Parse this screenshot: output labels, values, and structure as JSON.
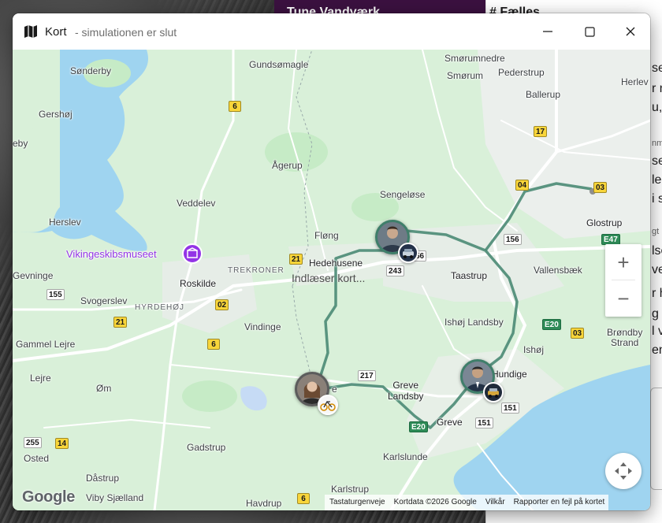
{
  "background": {
    "purple_panel_title": "Tune Vandværk",
    "chat_title": "# Fælles",
    "chat_fragments": [
      "se",
      "r n",
      "u,",
      "nm",
      "se",
      "leg",
      "i s",
      "gt",
      "lse",
      "ve",
      "r h",
      "g",
      "l v",
      "en",
      "ka"
    ]
  },
  "window": {
    "title": "Kort",
    "subtitle": "- simulationen er slut",
    "controls": {
      "minimize": "minimize",
      "maximize": "maximize",
      "close": "close"
    }
  },
  "map": {
    "loading_text": "Indlæser kort...",
    "places": {
      "gundsomagle": "Gundsømagle",
      "smorumnedre": "Smørumnedre",
      "sonderby": "Sønderby",
      "smorum": "Smørum",
      "pederstrup": "Pederstrup",
      "herlev": "Herlev",
      "ballerup": "Ballerup",
      "gershoj": "Gershøj",
      "eby": "eby",
      "agerup": "Ågerup",
      "veddelev": "Veddelev",
      "sengelose": "Sengeløse",
      "glostrup": "Glostrup",
      "herslev": "Herslev",
      "flong": "Fløng",
      "hedehusene": "Hedehusene",
      "trekroner": "TREKRONER",
      "roskilde": "Roskilde",
      "taastrup": "Taastrup",
      "vallensbaek": "Vallensbæk",
      "gevninge": "Gevninge",
      "svogerslev": "Svogerslev",
      "hyrdehoj": "HYRDEHØJ",
      "vindinge": "Vindinge",
      "ishoj_landsby": "Ishøj Landsby",
      "gammel_lejre": "Gammel Lejre",
      "ishoj": "Ishøj",
      "brondby_strand": "Brøndby\nStrand",
      "lejre": "Lejre",
      "hundige": "Hundige",
      "greve_landsby": "Greve\nLandsby",
      "om": "Øm",
      "greve": "Greve",
      "gadstrup": "Gadstrup",
      "osted": "Osted",
      "karlslunde": "Karlslunde",
      "dastrup": "Dåstrup",
      "karlstrup": "Karlstrup",
      "viby_sjaelland": "Viby Sjælland",
      "havdrup": "Havdrup",
      "e_fragment": "e"
    },
    "poi": {
      "vikingeskibsmuseet": "Vikingeskibsmuseet"
    },
    "road_shields": {
      "r6a": "6",
      "r17": "17",
      "r04": "04",
      "r03a": "03",
      "r156a": "156",
      "e47": "E47",
      "r21a": "21",
      "r56": "56",
      "r243": "243",
      "r155": "155",
      "r02": "02",
      "r21b": "21",
      "r6b": "6",
      "e20a": "E20",
      "r03b": "03",
      "r217": "217",
      "r151a": "151",
      "r151b": "151",
      "e20b": "E20",
      "r255": "255",
      "r14": "14",
      "r6c": "6"
    },
    "route_color": "#4a8a74",
    "water_color": "#9fd4f0",
    "land_color": "#d9f0d9",
    "markers": [
      {
        "id": "person-1",
        "vehicle": "car-icon"
      },
      {
        "id": "person-2",
        "vehicle": "bicycle-icon"
      },
      {
        "id": "person-3",
        "vehicle": "car-icon"
      }
    ],
    "zoom_in_symbol": "+",
    "zoom_out_symbol": "−",
    "google_logo": "Google",
    "attribution": {
      "shortcuts": "Tastaturgenveje",
      "mapdata": "Kortdata ©2026 Google",
      "terms": "Vilkår",
      "report": "Rapporter en fejl på kortet"
    }
  }
}
